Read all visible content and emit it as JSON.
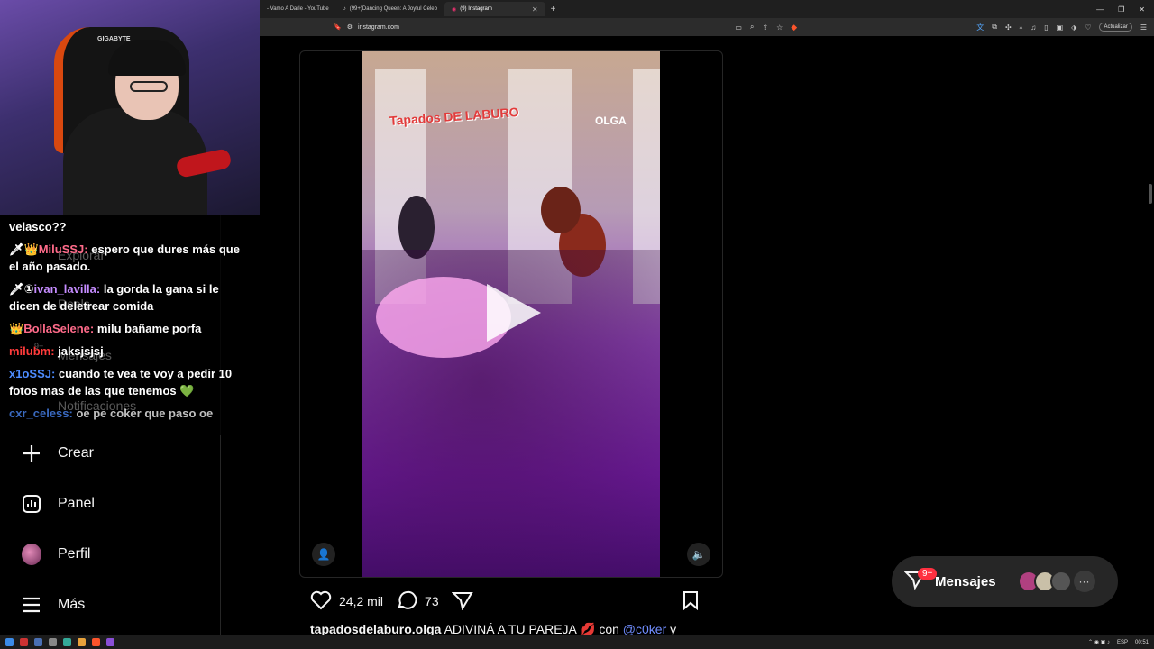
{
  "browser": {
    "tabs": [
      {
        "title": "- Vamo A Darle - YouTube",
        "active": false
      },
      {
        "title": "(99+)Dancing Queen: A Joyful Celeb",
        "active": false
      },
      {
        "title": "(9) Instagram",
        "active": true
      }
    ],
    "url": "instagram.com",
    "update_label": "Actualizar"
  },
  "sidebar": {
    "items": [
      {
        "label": "Crear",
        "icon": "plus-icon"
      },
      {
        "label": "Panel",
        "icon": "dashboard-icon"
      },
      {
        "label": "Perfil",
        "icon": "avatar"
      },
      {
        "label": "Más",
        "icon": "menu-icon"
      }
    ],
    "hidden_items": [
      "Explorar",
      "Reels",
      "Mensajes",
      "Notificaciones"
    ],
    "hidden_badge": "9+"
  },
  "webcam": {
    "brand": "GIGABYTE"
  },
  "chat": {
    "messages": [
      {
        "user": "",
        "text": "velasco??",
        "color": "#ffffff"
      },
      {
        "user": "MiluSSJ:",
        "text": " espero que dures más que el año pasado.",
        "color": "#ff6b8a"
      },
      {
        "user": "ivan_lavilla:",
        "text": " la gorda la gana si le dicen de deletrear comida",
        "color": "#c58cff"
      },
      {
        "user": "BollaSelene:",
        "text": " milu bañame porfa",
        "color": "#ff6b8a"
      },
      {
        "user": "milubm:",
        "text": " jaksjsjsj",
        "color": "#ff3b3b"
      },
      {
        "user": "x1oSSJ:",
        "text": " cuando te vea te voy a pedir 10 fotos mas de las que tenemos 💚",
        "color": "#4d8cff"
      },
      {
        "user": "cxr_celess:",
        "text": " oe pe coker que paso oe",
        "color": "#4d8cff"
      }
    ]
  },
  "post": {
    "logo_left": "Tapados DE LABURO",
    "logo_right": "OLGA",
    "likes": "24,2 mil",
    "comments": "73",
    "username": "tapadosdelaburo.olga",
    "caption_text": " ADIVINÁ A TU PAREJA 💋 con ",
    "mention": "@c0ker",
    "caption_tail": "  y"
  },
  "messages_pill": {
    "label": "Mensajes",
    "badge": "9+"
  },
  "taskbar": {
    "lang": "ESP",
    "time": "00:51"
  },
  "colors": {
    "accent_link": "#708dff",
    "badge": "#ff3040"
  }
}
